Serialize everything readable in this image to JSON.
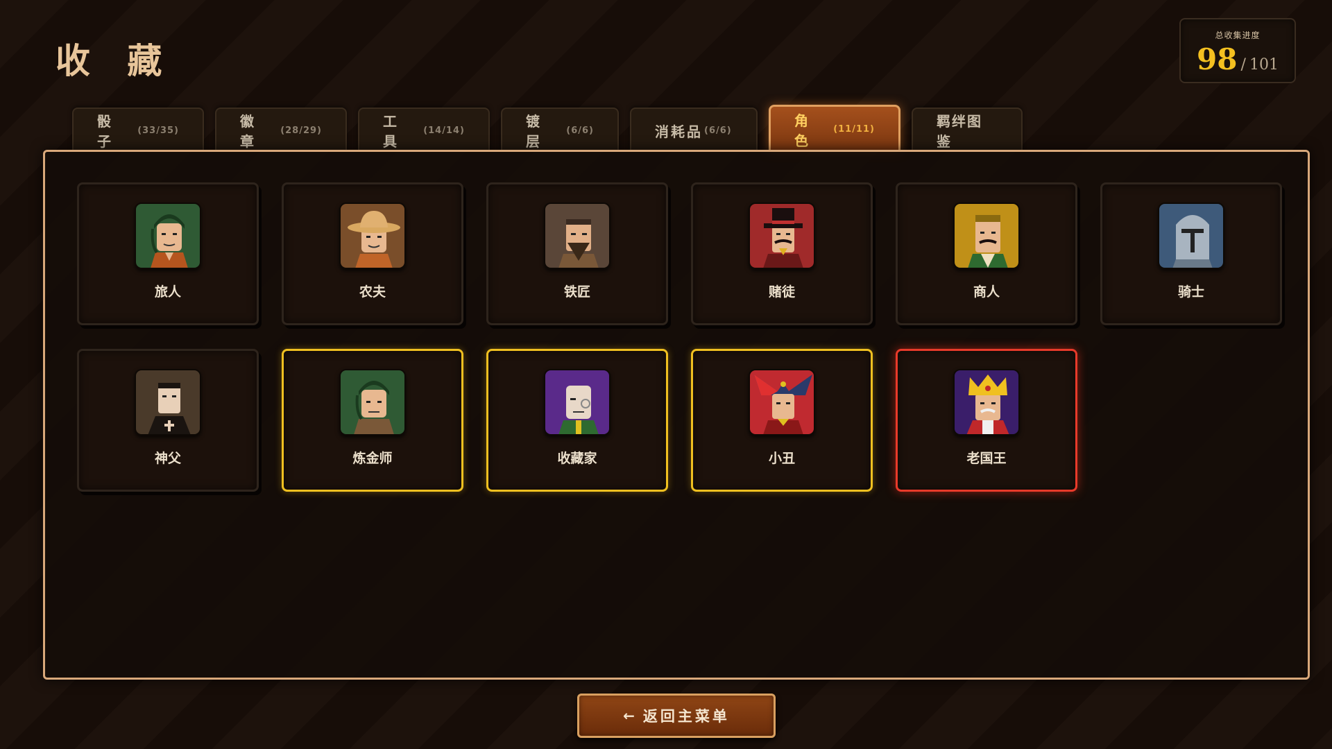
{
  "header": {
    "title": "收 藏"
  },
  "progress": {
    "label": "总收集进度",
    "current": "98",
    "separator": "/",
    "total": "101"
  },
  "tabs": [
    {
      "label": "骰 子",
      "count": "(33/35)",
      "active": false
    },
    {
      "label": "徽 章",
      "count": "(28/29)",
      "active": false
    },
    {
      "label": "工 具",
      "count": "(14/14)",
      "active": false
    },
    {
      "label": "镀 层",
      "count": "(6/6)",
      "active": false
    },
    {
      "label": "消耗品",
      "count": "(6/6)",
      "active": false
    },
    {
      "label": "角 色",
      "count": "(11/11)",
      "active": true
    },
    {
      "label": "羁绊图鉴",
      "count": "",
      "active": false
    }
  ],
  "cards": [
    {
      "name": "旅人",
      "icon": "traveler-icon",
      "highlight": "none"
    },
    {
      "name": "农夫",
      "icon": "farmer-icon",
      "highlight": "none"
    },
    {
      "name": "铁匠",
      "icon": "blacksmith-icon",
      "highlight": "none"
    },
    {
      "name": "赌徒",
      "icon": "gambler-icon",
      "highlight": "none"
    },
    {
      "name": "商人",
      "icon": "merchant-icon",
      "highlight": "none"
    },
    {
      "name": "骑士",
      "icon": "knight-icon",
      "highlight": "none"
    },
    {
      "name": "神父",
      "icon": "priest-icon",
      "highlight": "none"
    },
    {
      "name": "炼金师",
      "icon": "alchemist-icon",
      "highlight": "gold"
    },
    {
      "name": "收藏家",
      "icon": "collector-icon",
      "highlight": "gold"
    },
    {
      "name": "小丑",
      "icon": "jester-icon",
      "highlight": "gold"
    },
    {
      "name": "老国王",
      "icon": "old-king-icon",
      "highlight": "red"
    }
  ],
  "footer": {
    "back_arrow": "←",
    "back_label": "返回主菜单"
  },
  "colors": {
    "accent_gold": "#f4c020",
    "highlight_gold": "#f0c020",
    "highlight_red": "#e83a2a",
    "panel_border": "#d9a87a",
    "active_tab": "#a5501c"
  }
}
